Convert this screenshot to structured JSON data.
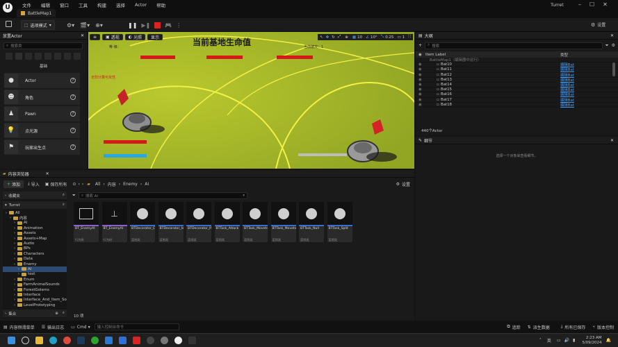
{
  "title_bar": {
    "tab": "BattleMap1",
    "project": "Turret",
    "menu": [
      "文件",
      "编辑",
      "窗口",
      "工具",
      "构建",
      "选择",
      "Actor",
      "帮助"
    ]
  },
  "toolbar": {
    "mode": "选项模式",
    "settings": "设置"
  },
  "place_actors": {
    "title": "放置Actor",
    "search_placeholder": "搜索类",
    "category": "基础",
    "items": [
      {
        "label": "Actor",
        "icon": "sphere-icon"
      },
      {
        "label": "角色",
        "icon": "character-icon"
      },
      {
        "label": "Pawn",
        "icon": "pawn-icon"
      },
      {
        "label": "点光源",
        "icon": "bulb-icon"
      },
      {
        "label": "玩家出生点",
        "icon": "flag-icon"
      }
    ]
  },
  "viewport": {
    "perspective": "透视",
    "lit": "光照",
    "show": "显示",
    "grid_snap": "10",
    "rot_snap": "10°",
    "scale_snap": "0.25",
    "cam_speed": "1",
    "hud_title": "当前基地生命值",
    "hud_left": "等 级：",
    "hud_right": "当前波次：1",
    "invincible": "无防计算可攻性"
  },
  "content_browser": {
    "title": "内容浏览器",
    "add": "添加",
    "import": "导入",
    "save_all": "保存所有",
    "path": [
      "All",
      "内容",
      "Enemy",
      "AI"
    ],
    "settings": "设置",
    "favorites": "收藏夹",
    "project": "Turret",
    "search_placeholder": "搜索 AI",
    "collections": "集合",
    "count": "10 项",
    "tree": [
      {
        "label": "All",
        "depth": 0
      },
      {
        "label": "内容",
        "depth": 1
      },
      {
        "label": "AI",
        "depth": 2
      },
      {
        "label": "Animation",
        "depth": 2
      },
      {
        "label": "Assets",
        "depth": 2
      },
      {
        "label": "Assets+Map",
        "depth": 2
      },
      {
        "label": "Audio",
        "depth": 2
      },
      {
        "label": "BPs",
        "depth": 2
      },
      {
        "label": "Characters",
        "depth": 2
      },
      {
        "label": "Data",
        "depth": 2
      },
      {
        "label": "Enemy",
        "depth": 2
      },
      {
        "label": "AI",
        "depth": 3,
        "selected": true
      },
      {
        "label": "test",
        "depth": 3
      },
      {
        "label": "Enum",
        "depth": 2
      },
      {
        "label": "FarmAnimalSounds",
        "depth": 2
      },
      {
        "label": "ForestGolems",
        "depth": 2
      },
      {
        "label": "Interface",
        "depth": 2
      },
      {
        "label": "Interface_And_Item_So",
        "depth": 2
      },
      {
        "label": "LevelPrototyping",
        "depth": 2
      }
    ],
    "assets": [
      {
        "name": "BT_EnemyAI",
        "type": "行为树",
        "color": "#8d5fd3"
      },
      {
        "name": "BT_EnemyAI",
        "type": "行为树",
        "color": "#8d5fd3"
      },
      {
        "name": "BTDecorator_CheckIsValid",
        "type": "蓝图类",
        "color": "#3a6cd4"
      },
      {
        "name": "BTDecorator_IsDead",
        "type": "蓝图类",
        "color": "#3a6cd4"
      },
      {
        "name": "BTDecorator_IfInvincesed",
        "type": "蓝图类",
        "color": "#3a6cd4"
      },
      {
        "name": "BTTask_Attack",
        "type": "蓝图类",
        "color": "#3a6cd4"
      },
      {
        "name": "BTTask_MovetoBase",
        "type": "蓝图类",
        "color": "#3a6cd4"
      },
      {
        "name": "BTTask_MovetoPlayer",
        "type": "蓝图类",
        "color": "#3a6cd4"
      },
      {
        "name": "BTTask_Null",
        "type": "蓝图类",
        "color": "#3a6cd4"
      },
      {
        "name": "BTTask_Split",
        "type": "蓝图类",
        "color": "#3a6cd4"
      }
    ]
  },
  "outliner": {
    "title": "大纲",
    "search_placeholder": "搜索",
    "col_label": "Item Label",
    "col_type": "类型",
    "root": "BattleMap1（编辑器中运行）",
    "rows": [
      {
        "label": "Bat10",
        "type": "编辑Bat"
      },
      {
        "label": "Bat11",
        "type": "编辑Bat"
      },
      {
        "label": "Bat12",
        "type": "编辑Bat"
      },
      {
        "label": "Bat13",
        "type": "编辑Bat"
      },
      {
        "label": "Bat14",
        "type": "编辑Bat"
      },
      {
        "label": "Bat15",
        "type": "编辑Bat"
      },
      {
        "label": "Bat16",
        "type": "编辑Bat"
      },
      {
        "label": "Bat17",
        "type": "编辑Bat"
      },
      {
        "label": "Bat18",
        "type": "编辑Bat"
      }
    ],
    "count": "440个Actor"
  },
  "details": {
    "title": "细节",
    "empty": "选择一个对象来查看细节。"
  },
  "status_bar": {
    "drawer": "内容侧滑菜单",
    "log": "输出日志",
    "cmd": "Cmd",
    "cmd_placeholder": "输入控制台命令",
    "trace": "追踪",
    "derived": "派生数据",
    "save_all": "所有已保存",
    "source": "版本控制"
  },
  "taskbar": {
    "lang": "英",
    "time": "2:23 AM",
    "date": "5/09/2024"
  }
}
